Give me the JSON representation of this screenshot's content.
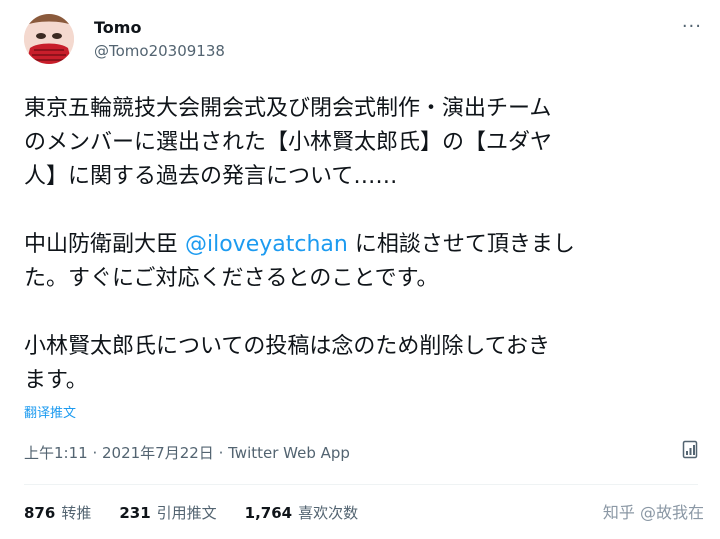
{
  "user": {
    "name": "Tomo",
    "handle": "@Tomo20309138"
  },
  "tweet": {
    "line1": "東京五輪競技大会開会式及び閉会式制作・演出チーム",
    "line2": "のメンバーに選出された【小林賢太郎氏】の【ユダヤ",
    "line3": "人】に関する過去の発言について……",
    "p2_pre": "中山防衛副大臣 ",
    "mention": "@iloveyatchan",
    "p2_post": " に相談させて頂きまし",
    "line5": "た。すぐにご対応くださるとのことです。",
    "line6": "小林賢太郎氏についての投稿は念のため削除しておき",
    "line7": "ます。"
  },
  "translate_label": "翻译推文",
  "meta": {
    "time": "上午1:11",
    "sep1": " · ",
    "date": "2021年7月22日",
    "sep2": " · ",
    "source": "Twitter Web App"
  },
  "stats": {
    "retweets_count": "876",
    "retweets_label": "转推",
    "quotes_count": "231",
    "quotes_label": "引用推文",
    "likes_count": "1,764",
    "likes_label": "喜欢次数"
  },
  "watermark": "知乎 @故我在",
  "icons": {
    "more": "more-icon",
    "analytics": "analytics-icon"
  },
  "colors": {
    "accent": "#1d9bf0",
    "secondary_text": "#536471"
  }
}
